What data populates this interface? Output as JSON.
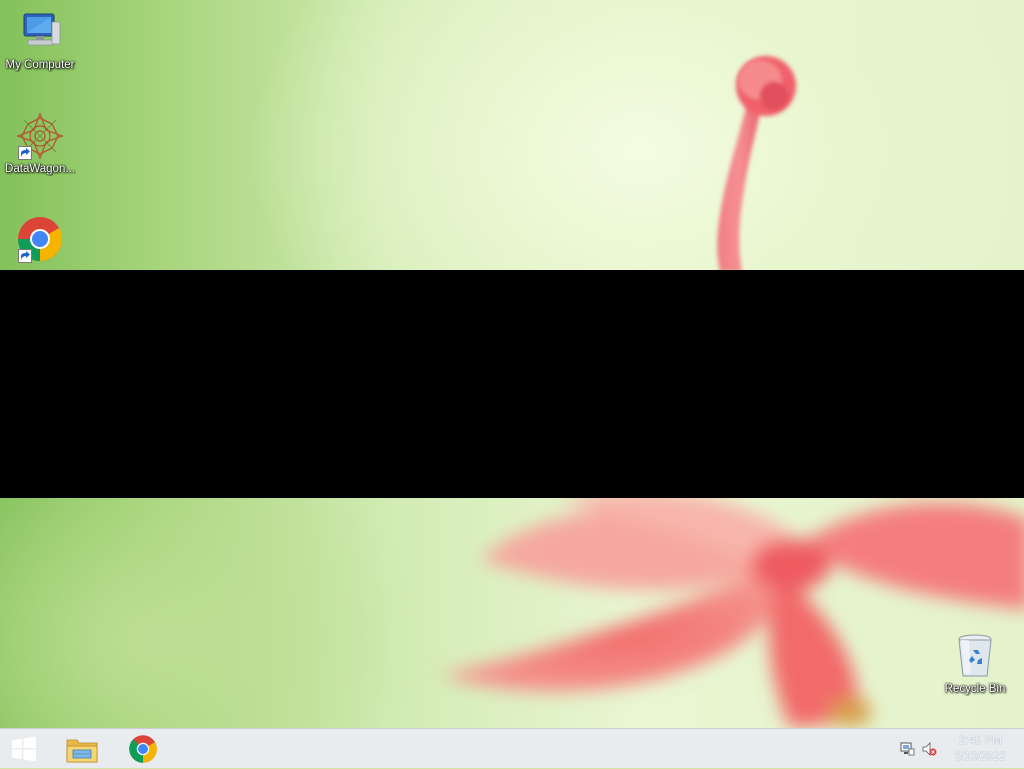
{
  "desktop": {
    "icons": [
      {
        "label": "My Computer",
        "icon": "computer-icon"
      },
      {
        "label": "DataWagon...",
        "icon": "datawagon-icon"
      },
      {
        "label": "",
        "icon": "chrome-icon"
      },
      {
        "label": "Recycle Bin",
        "icon": "recycle-bin-icon"
      }
    ]
  },
  "taskbar": {
    "start_icon": "windows-logo-icon",
    "pinned": [
      {
        "icon": "file-explorer-icon"
      },
      {
        "icon": "chrome-icon"
      }
    ],
    "tray": {
      "icons": [
        "network-icon",
        "volume-muted-icon"
      ],
      "time": "2:45 PM",
      "date": "5/10/2022"
    }
  },
  "colors": {
    "wallpaper_green": "#a8d57c",
    "flower_red": "#f06a6a",
    "taskbar_bg": "#e8ecef"
  }
}
